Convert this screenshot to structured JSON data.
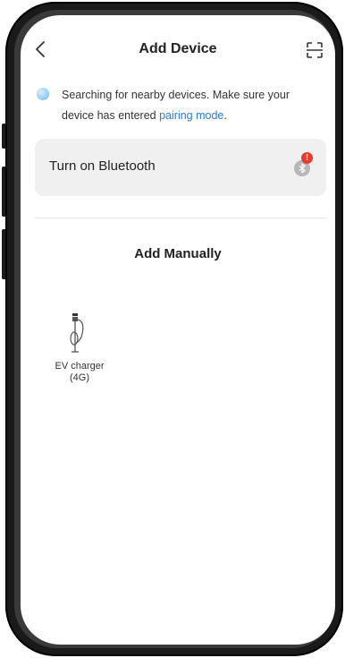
{
  "header": {
    "title": "Add Device",
    "back_icon": "chevron-left-icon",
    "scan_icon": "scan-icon"
  },
  "notice": {
    "text": "Searching for nearby devices. Make sure your device has entered ",
    "link_text": "pairing mode",
    "trailing": "."
  },
  "bluetooth": {
    "label": "Turn on Bluetooth",
    "icon": "bluetooth-icon",
    "alert": "!"
  },
  "manual": {
    "title": "Add Manually",
    "devices": [
      {
        "label_line1": "EV charger",
        "label_line2": "(4G)",
        "icon": "ev-charger-icon"
      }
    ]
  },
  "colors": {
    "accent_link": "#2a7bd8",
    "alert": "#e8392f",
    "card_bg": "#f0f0f1"
  }
}
